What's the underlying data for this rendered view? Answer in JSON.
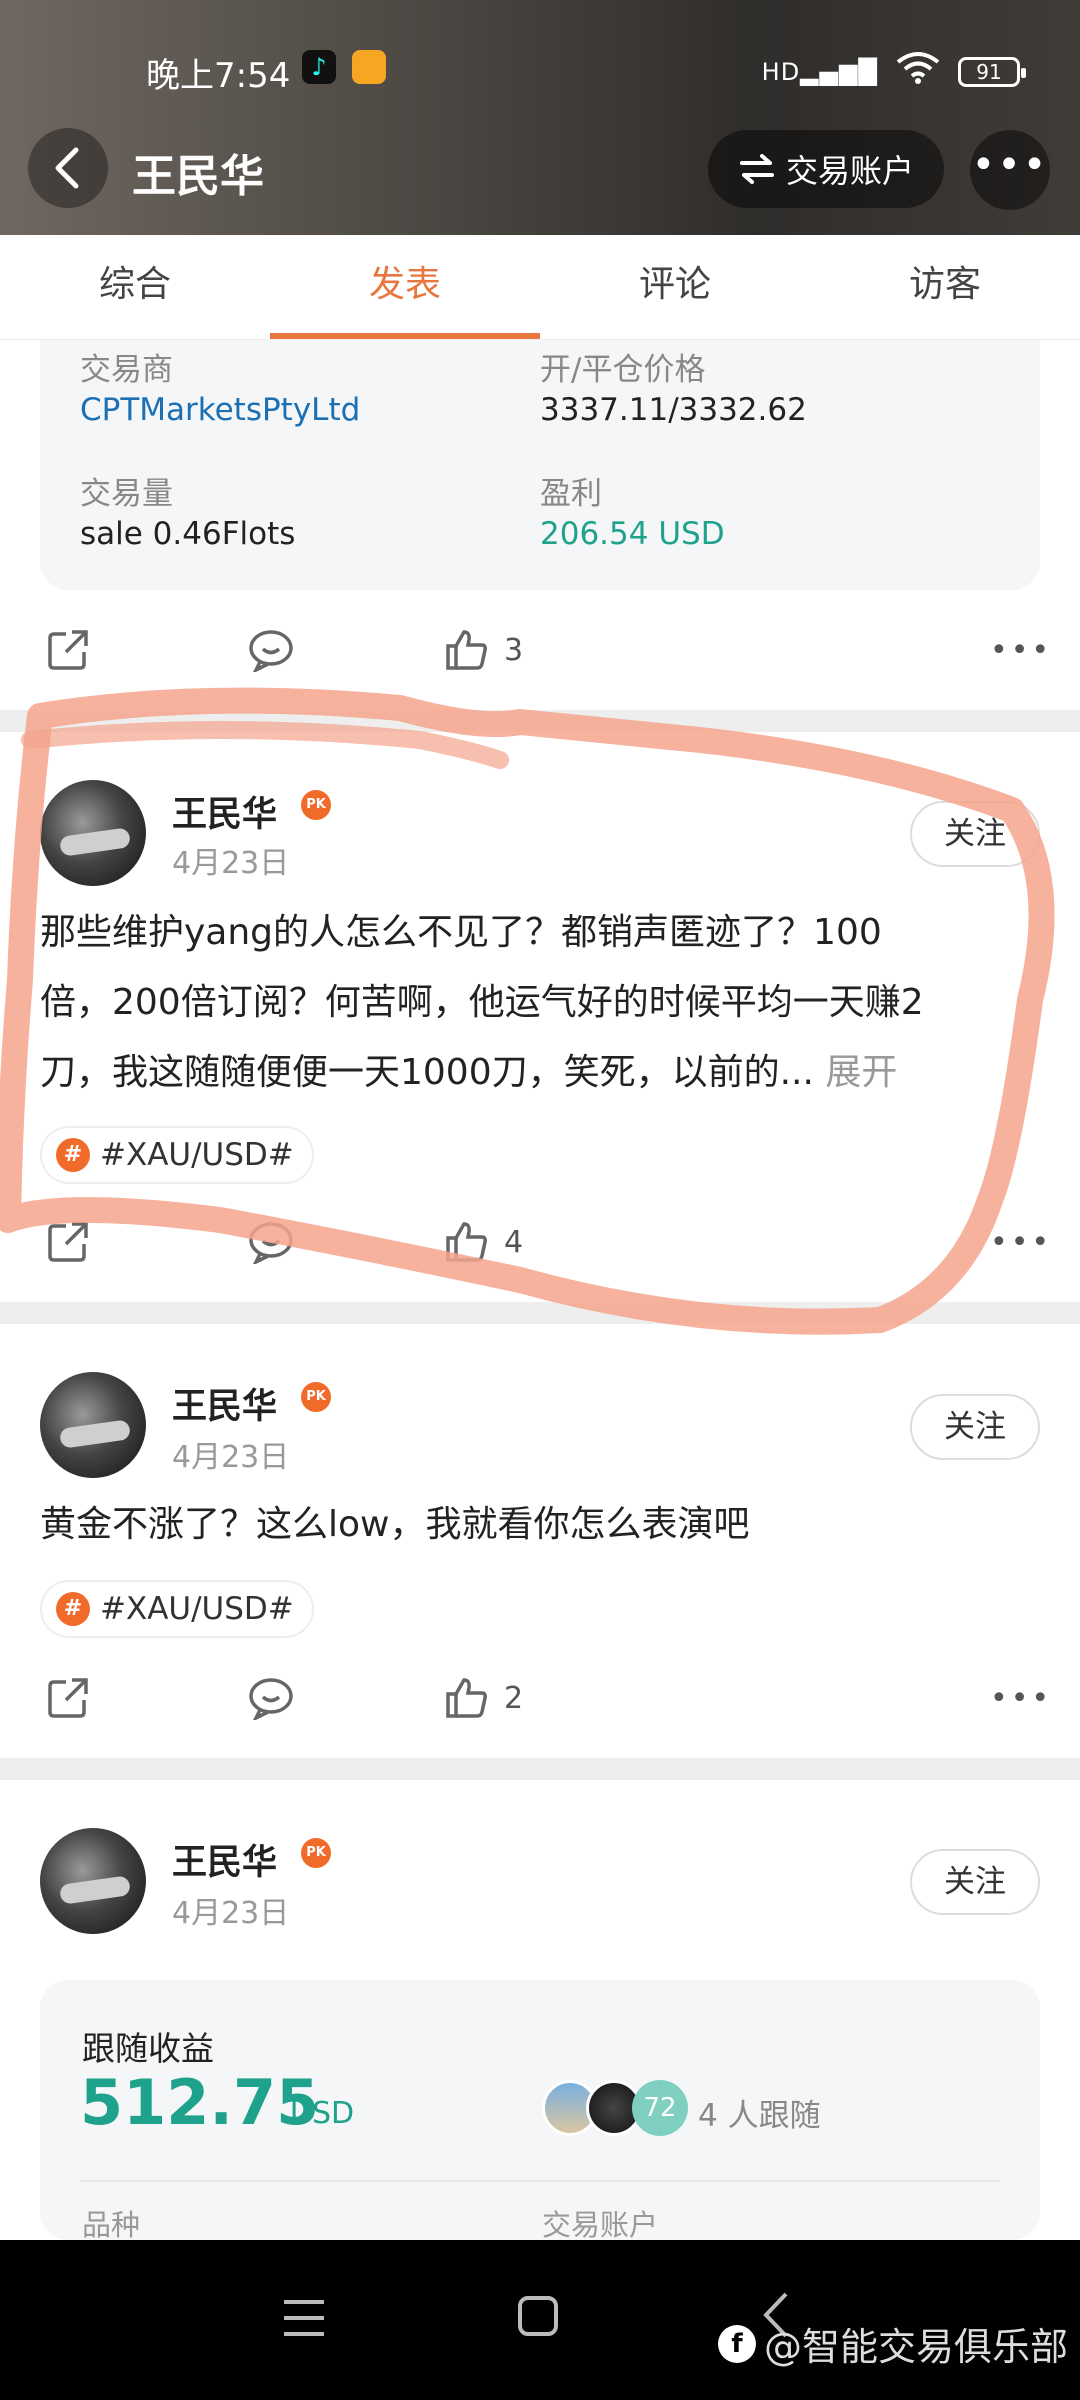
{
  "status_bar": {
    "time": "晚上7:54",
    "signal": "HD",
    "battery": "91"
  },
  "header": {
    "title": "王民华",
    "trade_account_label": "交易账户"
  },
  "tabs": [
    "综合",
    "发表",
    "评论",
    "访客"
  ],
  "active_tab": "发表",
  "trade_card": {
    "broker_label": "交易商",
    "broker": "CPTMarketsPtyLtd",
    "price_label": "开/平仓价格",
    "price": "3337.11/3332.62",
    "volume_label": "交易量",
    "volume": "sale 0.46Flots",
    "profit_label": "盈利",
    "profit": "206.54 USD"
  },
  "trade_actions": {
    "likes": "3"
  },
  "posts": [
    {
      "author": "王民华",
      "badge": "PK",
      "date": "4月23日",
      "follow_label": "关注",
      "lines": [
        "那些维护yang的人怎么不见了？都销声匿迹了？100",
        "倍，200倍订阅？何苦啊，他运气好的时候平均一天赚2",
        "刀，我这随随便便一天1000刀，笑死，以前的... "
      ],
      "expand_label": "展开",
      "tag": "#XAU/USD#",
      "likes": "4"
    },
    {
      "author": "王民华",
      "badge": "PK",
      "date": "4月23日",
      "follow_label": "关注",
      "text": "黄金不涨了？这么low，我就看你怎么表演吧",
      "tag": "#XAU/USD#",
      "likes": "2"
    },
    {
      "author": "王民华",
      "badge": "PK",
      "date": "4月23日",
      "follow_label": "关注"
    }
  ],
  "earnings": {
    "label": "跟随收益",
    "value": "512.75",
    "unit": "USD",
    "follower_count_badge": "72",
    "followers_text": "4 人跟随",
    "sub_label_left": "品种",
    "sub_label_right": "交易账户"
  },
  "watermark": {
    "logo": "f",
    "text": "@智能交易俱乐部"
  },
  "colors": {
    "accent": "#e8763f",
    "profit_green": "#1fa28c",
    "link_blue": "#1b6fb3",
    "highlight": "#f4a48c"
  }
}
